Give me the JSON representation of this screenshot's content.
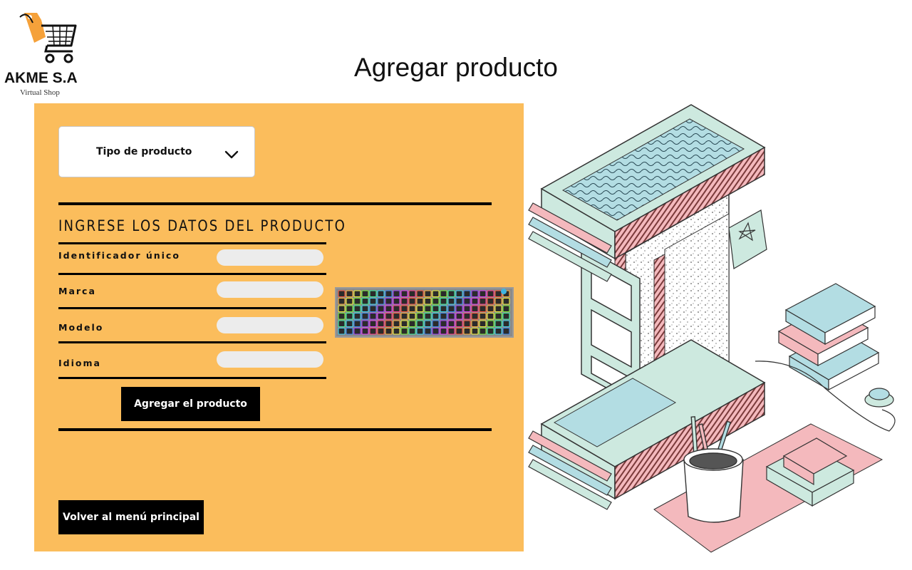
{
  "logo": {
    "name": "AKME S.A",
    "subtitle": "Virtual Shop"
  },
  "page": {
    "title": "Agregar producto"
  },
  "form": {
    "product_type_select": {
      "label": "Tipo de producto"
    },
    "section_heading": "INGRESE LOS DATOS DEL PRODUCTO",
    "fields": [
      {
        "label": "Identificador único",
        "value": ""
      },
      {
        "label": "Marca",
        "value": ""
      },
      {
        "label": "Modelo",
        "value": ""
      },
      {
        "label": "Idioma",
        "value": ""
      }
    ],
    "submit_label": "Agregar el producto",
    "back_label": "Volver al menú principal"
  },
  "colors": {
    "panel": "#fbbd5c",
    "logo_orange": "#f5a13a",
    "illustration_mint": "#cde9df",
    "illustration_pink": "#f4b9bd",
    "illustration_blue": "#b3dde3"
  },
  "icons": [
    "shopping-cart-icon",
    "chevron-down-icon"
  ]
}
